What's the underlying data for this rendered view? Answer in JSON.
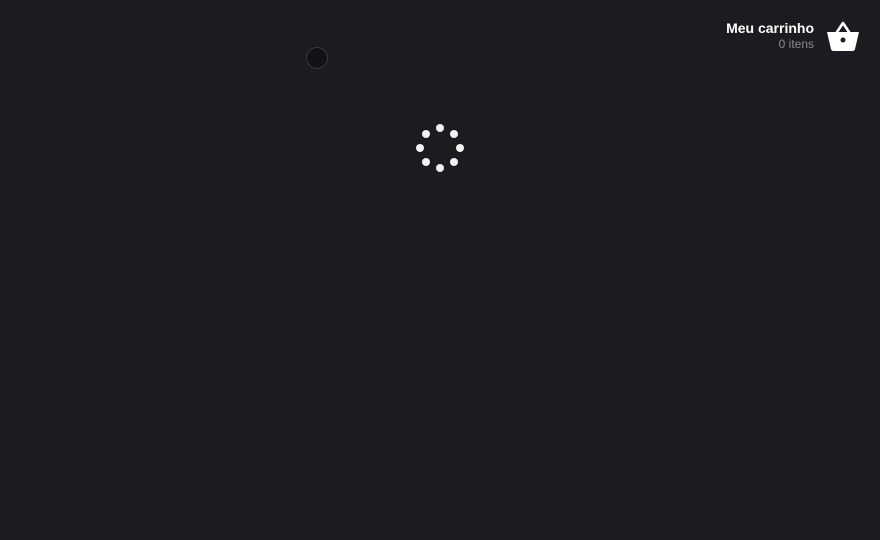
{
  "cart": {
    "title": "Meu carrinho",
    "count": "0 itens",
    "icon": "basket-icon"
  },
  "loader": {
    "icon": "loading-spinner-icon"
  },
  "colors": {
    "background": "#1b1c20",
    "text_primary": "#ffffff",
    "text_secondary": "#8a8b90",
    "spinner_dot": "#f2f2f2"
  }
}
